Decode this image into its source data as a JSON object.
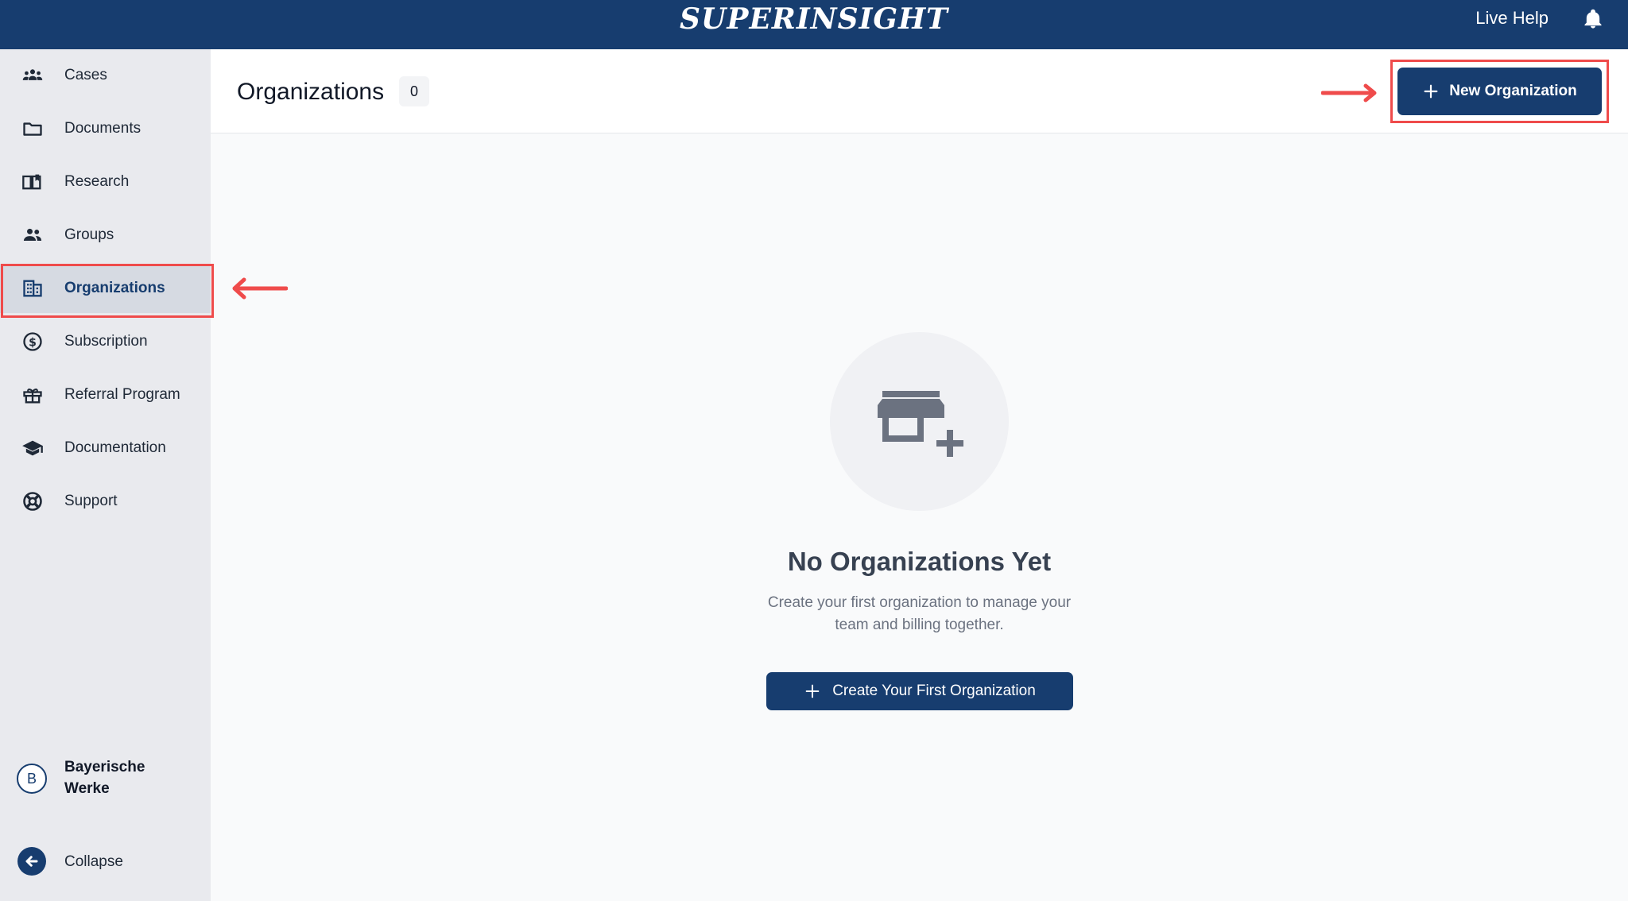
{
  "header": {
    "brand": "SUPERINSIGHT",
    "live_help": "Live Help"
  },
  "sidebar": {
    "items": [
      {
        "label": "Cases",
        "icon": "people-group-icon"
      },
      {
        "label": "Documents",
        "icon": "folder-icon"
      },
      {
        "label": "Research",
        "icon": "open-book-icon"
      },
      {
        "label": "Groups",
        "icon": "group-icon"
      },
      {
        "label": "Organizations",
        "icon": "building-icon",
        "active": true
      },
      {
        "label": "Subscription",
        "icon": "dollar-circle-icon"
      },
      {
        "label": "Referral Program",
        "icon": "gift-icon"
      },
      {
        "label": "Documentation",
        "icon": "graduation-cap-icon"
      },
      {
        "label": "Support",
        "icon": "lifebuoy-icon"
      }
    ],
    "account": {
      "initial": "B",
      "name": "Bayerische Werke"
    },
    "collapse_label": "Collapse"
  },
  "page": {
    "title": "Organizations",
    "count": "0",
    "new_button_label": "New Organization"
  },
  "empty_state": {
    "title": "No Organizations Yet",
    "description": "Create your first organization to manage your team and billing together.",
    "button_label": "Create Your First Organization"
  },
  "colors": {
    "brand": "#173d6f",
    "highlight": "#ef4b4b",
    "sidebar_bg": "#e9eaee",
    "page_bg": "#f9fafb"
  }
}
